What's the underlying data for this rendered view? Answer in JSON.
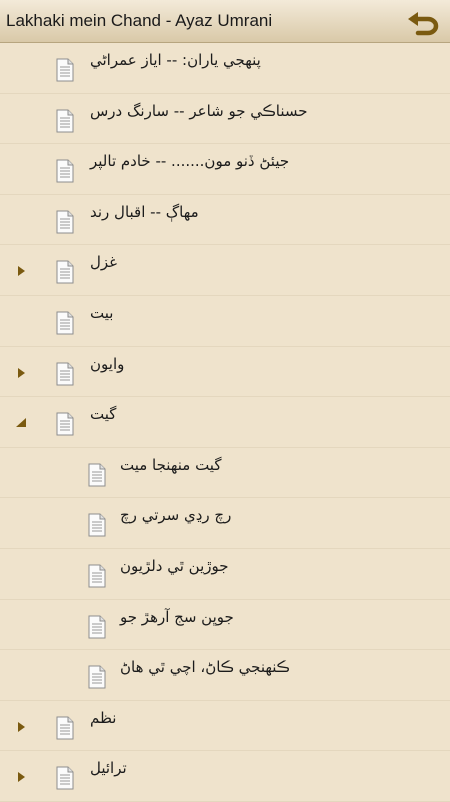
{
  "header": {
    "title": "Lakhaki mein Chand - Ayaz Umrani",
    "back_icon": "undo-arrow-icon"
  },
  "items": [
    {
      "label": "پنهجي ياران: -- اياز عمراڻي",
      "level": 0,
      "arrow": "none"
    },
    {
      "label": "حسناڪي جو شاعر -- سارنگ درس",
      "level": 0,
      "arrow": "none"
    },
    {
      "label": "جيئڻ ڏنو مون....... -- خادم تالپر",
      "level": 0,
      "arrow": "none"
    },
    {
      "label": "مهاڳ -- اقبال رند",
      "level": 0,
      "arrow": "none"
    },
    {
      "label": "غزل",
      "level": 0,
      "arrow": "collapsed"
    },
    {
      "label": "بيت",
      "level": 0,
      "arrow": "none"
    },
    {
      "label": "وايون",
      "level": 0,
      "arrow": "collapsed"
    },
    {
      "label": "گيت",
      "level": 0,
      "arrow": "expanded"
    },
    {
      "label": "گيت منهنجا ميت",
      "level": 1,
      "arrow": "none"
    },
    {
      "label": "رچ رڍي سرتي رچ",
      "level": 1,
      "arrow": "none"
    },
    {
      "label": "جوڙين ٿي دلڙيون",
      "level": 1,
      "arrow": "none"
    },
    {
      "label": "جوڀن سج آرهڙ جو",
      "level": 1,
      "arrow": "none"
    },
    {
      "label": "ڪنهنجي ڪاڻ، اچي ٿي هاڻ",
      "level": 1,
      "arrow": "none"
    },
    {
      "label": "نظم",
      "level": 0,
      "arrow": "collapsed"
    },
    {
      "label": "ترائيل",
      "level": 0,
      "arrow": "collapsed"
    }
  ],
  "colors": {
    "background": "#efe3cc",
    "arrow": "#7a5a10",
    "back_icon": "#8a6a1a"
  }
}
